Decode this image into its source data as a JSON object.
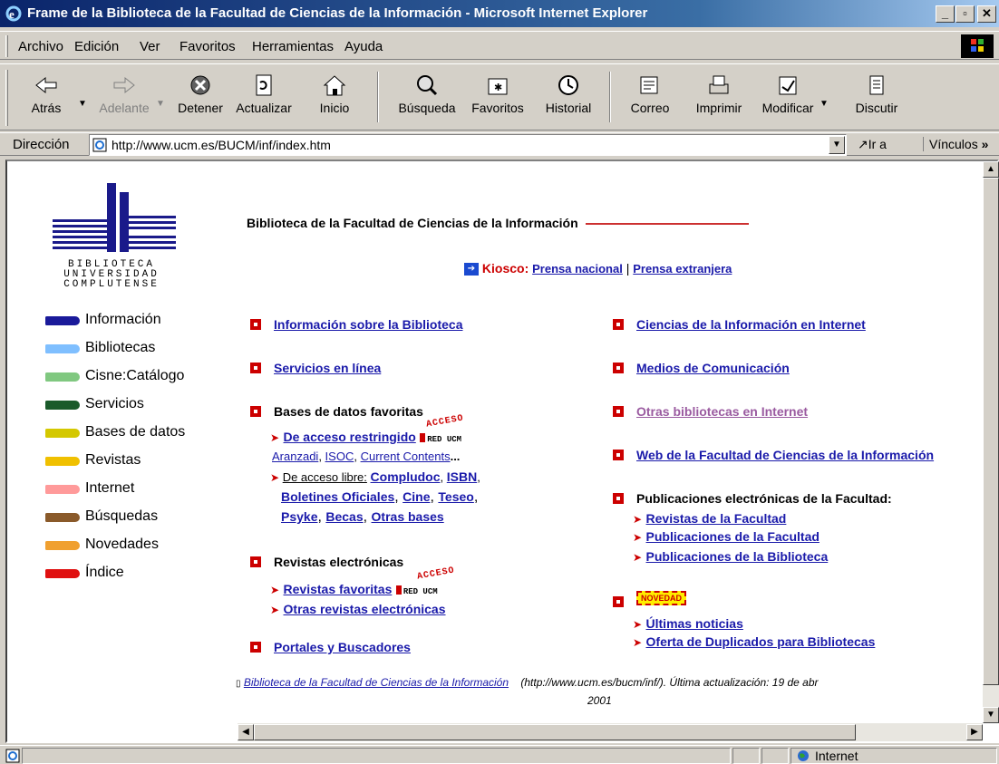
{
  "window": {
    "title": "Frame de la Biblioteca de la Facultad de Ciencias de la Información - Microsoft Internet Explorer"
  },
  "menubar": [
    "Archivo",
    "Edición",
    "Ver",
    "Favoritos",
    "Herramientas",
    "Ayuda"
  ],
  "toolbar": {
    "back": "Atrás",
    "forward": "Adelante",
    "stop": "Detener",
    "refresh": "Actualizar",
    "home": "Inicio",
    "search": "Búsqueda",
    "favorites": "Favoritos",
    "history": "Historial",
    "mail": "Correo",
    "print": "Imprimir",
    "edit": "Modificar",
    "discuss": "Discutir"
  },
  "address": {
    "label": "Dirección",
    "url": "http://www.ucm.es/BUCM/inf/index.htm",
    "go": "Ir a",
    "links": "Vínculos"
  },
  "logo": {
    "line1": "BIBLIOTECA",
    "line2": "UNIVERSIDAD",
    "line3": "COMPLUTENSE"
  },
  "nav": [
    {
      "label": "Información",
      "color": "#1a1a9a"
    },
    {
      "label": "Bibliotecas",
      "color": "#7fbfff"
    },
    {
      "label": "Cisne:Catálogo",
      "color": "#80c880"
    },
    {
      "label": "Servicios",
      "color": "#1a5a2a"
    },
    {
      "label": "Bases de datos",
      "color": "#d4c800"
    },
    {
      "label": "Revistas",
      "color": "#f0c000"
    },
    {
      "label": "Internet",
      "color": "#ff9a9a"
    },
    {
      "label": "Búsquedas",
      "color": "#8a5a2a"
    },
    {
      "label": "Novedades",
      "color": "#f0a030"
    },
    {
      "label": "Índice",
      "color": "#e01010"
    }
  ],
  "main": {
    "heading": "Biblioteca de la Facultad de Ciencias de la Información",
    "kiosco": "Kiosco:",
    "prensa_nacional": "Prensa nacional",
    "sep": "|",
    "prensa_extranjera": "Prensa extranjera",
    "left": {
      "info": "Información sobre la Biblioteca",
      "servicios": "Servicios en línea",
      "bases": "Bases de datos favoritas",
      "restringido": "De acceso restringido",
      "acceso": "ACCESO",
      "redUcm": "RED UCM",
      "aranzadi": "Aranzadi",
      "isoc": "ISOC",
      "current": "Current Contents",
      "ellipsis": "...",
      "libre": "De acceso libre:",
      "compludoc": "Compludoc",
      "isbn": "ISBN",
      "boletines": "Boletines Oficiales",
      "cine": "Cine",
      "teseo": "Teseo",
      "psyke": "Psyke",
      "becas": "Becas",
      "otras_bases": "Otras bases",
      "revistas": "Revistas electrónicas",
      "rev_fav": "Revistas favoritas",
      "otras_rev": "Otras revistas electrónicas",
      "portales": "Portales y Buscadores"
    },
    "right": {
      "ciencias": "Ciencias de la Información en Internet",
      "medios": "Medios de Comunicación",
      "otras_bib": "Otras bibliotecas en Internet",
      "web": "Web de la Facultad de Ciencias de la Información",
      "publicaciones": "Publicaciones electrónicas de la Facultad:",
      "rev_fac": "Revistas de la Facultad",
      "pub_fac": "Publicaciones de la Facultad",
      "pub_bib": "Publicaciones de la Biblioteca",
      "novedad": "NOVEDAD",
      "noticias": "Últimas noticias",
      "duplicados": "Oferta de Duplicados para Bibliotecas"
    },
    "footer_link": "Biblioteca de la Facultad de Ciencias de la Información",
    "footer_text": "(http://www.ucm.es/bucm/inf/). Última actualización: 19 de abr",
    "footer_year": "2001"
  },
  "status": {
    "zone": "Internet"
  }
}
